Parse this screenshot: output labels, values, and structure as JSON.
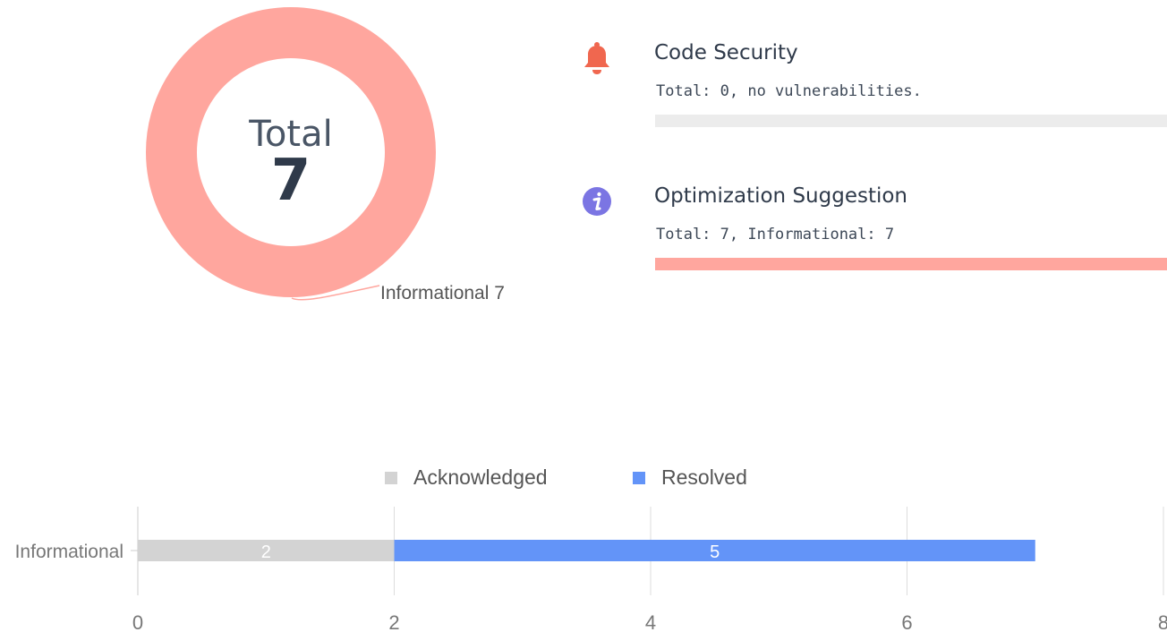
{
  "donut": {
    "title": "Total",
    "total": "7",
    "slices": [
      {
        "name": "Informational",
        "value": 7,
        "color": "#ffa69e"
      }
    ],
    "label": "Informational 7"
  },
  "categories": [
    {
      "name": "Code Security",
      "icon": "bell-icon",
      "icon_color": "#f0674f",
      "summary": "Total: 0, no vulnerabilities.",
      "fraction": 0,
      "fill_color": "#ffa69e"
    },
    {
      "name": "Optimization Suggestion",
      "icon": "info-icon",
      "icon_color": "#7b75e3",
      "summary": "Total: 7, Informational: 7",
      "fraction": 1,
      "fill_color": "#ffa69e"
    }
  ],
  "chart_data": {
    "type": "bar",
    "orientation": "horizontal",
    "stacked": true,
    "categories": [
      "Informational"
    ],
    "series": [
      {
        "name": "Acknowledged",
        "values": [
          2
        ],
        "color": "#d3d3d3",
        "labels": [
          "2"
        ]
      },
      {
        "name": "Resolved",
        "values": [
          5
        ],
        "color": "#6394f8",
        "labels": [
          "5"
        ]
      }
    ],
    "xlim": [
      0,
      8
    ],
    "xticks": [
      "0",
      "2",
      "4",
      "6",
      "8"
    ],
    "grid": true,
    "legend": "top"
  }
}
